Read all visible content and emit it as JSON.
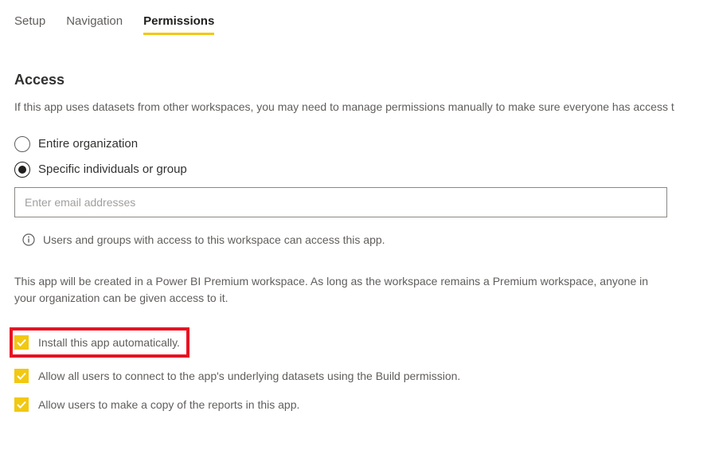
{
  "tabs": {
    "setup": "Setup",
    "navigation": "Navigation",
    "permissions": "Permissions"
  },
  "section": {
    "title": "Access",
    "description": "If this app uses datasets from other workspaces, you may need to manage permissions manually to make sure everyone has access t"
  },
  "radios": {
    "entire_org": "Entire organization",
    "specific": "Specific individuals or group"
  },
  "email_input": {
    "placeholder": "Enter email addresses",
    "value": ""
  },
  "info_text": "Users and groups with access to this workspace can access this app.",
  "premium_note": "This app will be created in a Power BI Premium workspace. As long as the workspace remains a Premium workspace, anyone in your organization can be given access to it.",
  "checkboxes": {
    "install_auto": "Install this app automatically.",
    "allow_build": "Allow all users to connect to the app's underlying datasets using the Build permission.",
    "allow_copy": "Allow users to make a copy of the reports in this app."
  }
}
